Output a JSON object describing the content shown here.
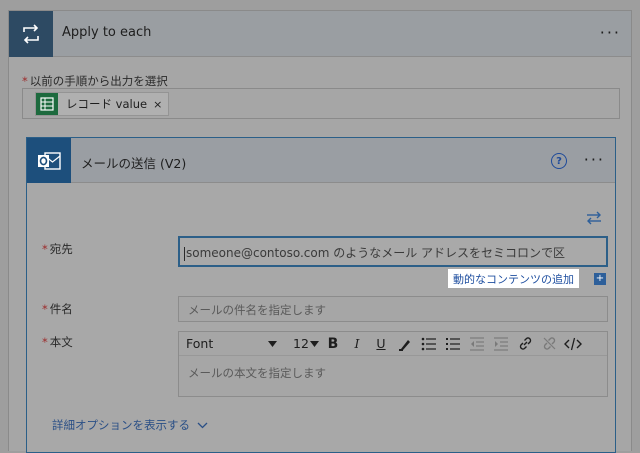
{
  "apply_to_each": {
    "title": "Apply to each",
    "menu": "···",
    "icon": "loop-icon",
    "select_label_star": "*",
    "select_label": "以前の手順から出力を選択",
    "token": {
      "label": "レコード value",
      "remove": "×",
      "icon": "excel-table-icon"
    }
  },
  "send_email": {
    "title": "メールの送信 (V2)",
    "help": "?",
    "menu": "···",
    "icon": "outlook-icon",
    "to": {
      "star": "*",
      "label": "宛先",
      "placeholder": "someone@contoso.com のようなメール アドレスをセミコロンで区"
    },
    "dynamic_content": {
      "label": "動的なコンテンツの追加",
      "plus": "+"
    },
    "subject": {
      "star": "*",
      "label": "件名",
      "placeholder": "メールの件名を指定します"
    },
    "body": {
      "star": "*",
      "label": "本文",
      "placeholder": "メールの本文を指定します",
      "toolbar": {
        "font": "Font",
        "size": "12",
        "bold": "B",
        "italic": "I",
        "underline": "U"
      }
    },
    "advanced_options": "詳細オプションを表示する"
  },
  "colors": {
    "loop_header": "#2d4a63",
    "outlook": "#1d4f7c",
    "excel": "#1d6a3e",
    "focus_border": "#2c5f88",
    "link": "#1f4fa0"
  }
}
